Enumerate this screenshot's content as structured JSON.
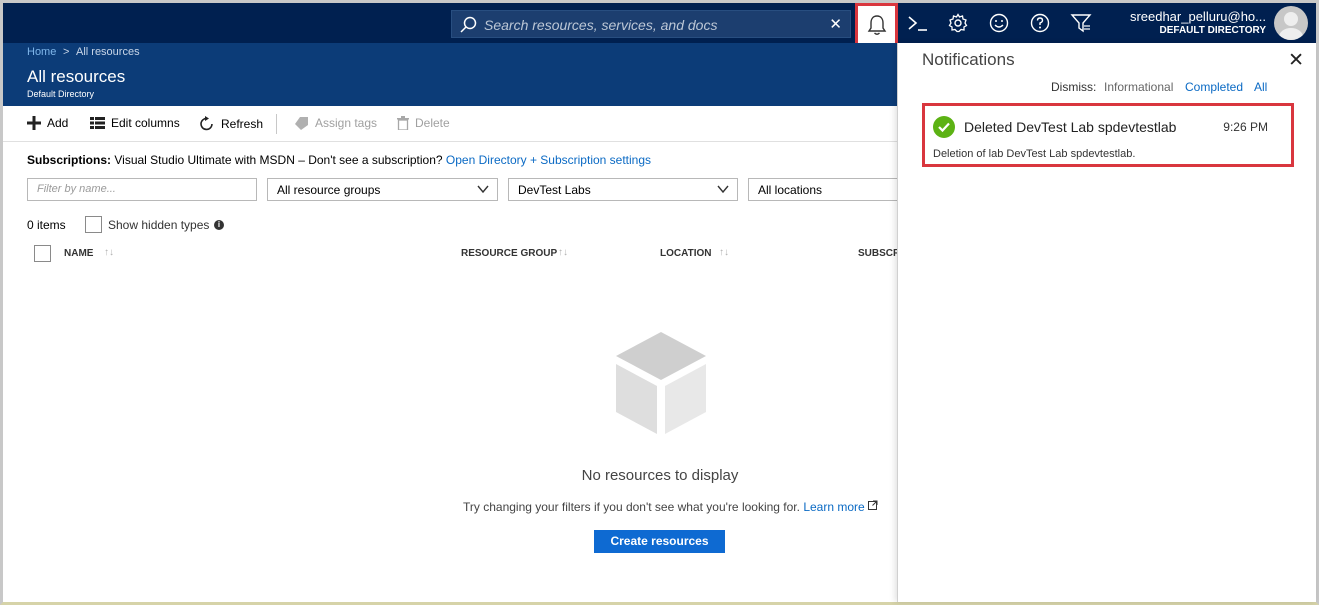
{
  "topbar": {
    "search_placeholder": "Search resources, services, and docs",
    "search_clear": "✕",
    "user_name": "sreedhar_pelluru@ho...",
    "user_directory": "DEFAULT DIRECTORY",
    "icons": [
      "bell-icon",
      "cloud-shell-icon",
      "gear-icon",
      "smiley-icon",
      "help-icon",
      "directory-filter-icon"
    ]
  },
  "breadcrumb": {
    "home": "Home",
    "separator": ">",
    "current": "All resources"
  },
  "blade": {
    "title": "All resources",
    "subtitle": "Default Directory"
  },
  "toolbar": {
    "add": "Add",
    "edit_columns": "Edit columns",
    "refresh": "Refresh",
    "assign_tags": "Assign tags",
    "delete": "Delete"
  },
  "subscriptions": {
    "label": "Subscriptions:",
    "value": "Visual Studio Ultimate with MSDN – Don't see a subscription?",
    "link": "Open Directory + Subscription settings"
  },
  "filters": {
    "name_placeholder": "Filter by name...",
    "resource_groups": "All resource groups",
    "types": "DevTest Labs",
    "locations": "All locations"
  },
  "list": {
    "count": "0 items",
    "show_hidden": "Show hidden types",
    "info": "i",
    "sort_arrow": "↑↓",
    "columns": [
      "NAME",
      "RESOURCE GROUP",
      "LOCATION",
      "SUBSCRI"
    ]
  },
  "empty": {
    "title": "No resources to display",
    "hint": "Try changing your filters if you don't see what you're looking for.",
    "learn_more": "Learn more",
    "create": "Create resources"
  },
  "notifications": {
    "title": "Notifications",
    "close": "✕",
    "dismiss_label": "Dismiss:",
    "dismiss_informational": "Informational",
    "dismiss_completed": "Completed",
    "dismiss_all": "All",
    "items": [
      {
        "title": "Deleted DevTest Lab spdevtestlab",
        "time": "9:26 PM",
        "description": "Deletion of lab DevTest Lab spdevtestlab.",
        "status": "success"
      }
    ]
  },
  "colors": {
    "topbar": "#002050",
    "blade_header": "#0c3c78",
    "link": "#0b6ac4",
    "primary_button": "#0e6ad2",
    "success": "#5cb214",
    "highlight": "#d9363e"
  }
}
